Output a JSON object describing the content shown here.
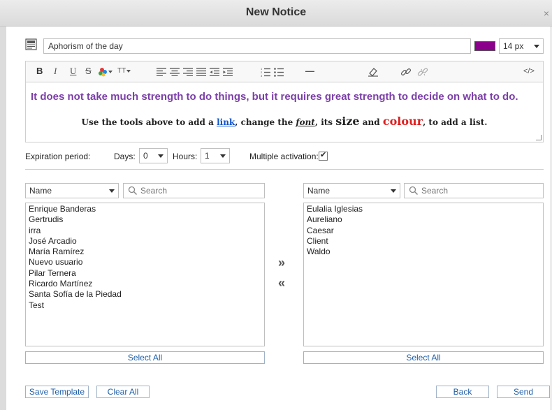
{
  "dialog": {
    "title": "New Notice",
    "close_glyph": "×"
  },
  "subject": {
    "value": "Aphorism of the day",
    "icon": "notice-icon"
  },
  "text_color": "#8b008b",
  "font_size": "14 px",
  "toolbar": {
    "bold": "B",
    "italic": "I",
    "underline": "U",
    "strike": "S",
    "font_size_glyph": "TT",
    "hr": "—",
    "source": "</>"
  },
  "editor": {
    "quote": "It does not take much strength to do things, but it requires great strength to decide on what to do.",
    "instr_1": "Use the tools above to add a ",
    "instr_link": "link",
    "instr_2": ", change the ",
    "instr_font": "font",
    "instr_3": ", its ",
    "instr_size": "size",
    "instr_4": " and ",
    "instr_colour": "colour",
    "instr_5": ", to add a list."
  },
  "expiration": {
    "label": "Expiration period:",
    "days_label": "Days:",
    "days_value": "0",
    "hours_label": "Hours:",
    "hours_value": "1",
    "multiple_label": "Multiple activation:",
    "multiple_checked": true
  },
  "left_panel": {
    "sort_value": "Name",
    "search_placeholder": "Search",
    "items": [
      "Enrique Banderas",
      "Gertrudis",
      "irra",
      "José Arcadio",
      "María Ramírez",
      "Nuevo usuario",
      "Pilar Ternera",
      "Ricardo Martínez",
      "Santa Sofía de la Piedad",
      "Test"
    ],
    "select_all": "Select All"
  },
  "transfer": {
    "right": "»",
    "left": "«"
  },
  "right_panel": {
    "sort_value": "Name",
    "search_placeholder": "Search",
    "items": [
      "Eulalia Iglesias",
      "Aureliano",
      "Caesar",
      "Client",
      "Waldo"
    ],
    "select_all": "Select All"
  },
  "footer": {
    "save_template": "Save Template",
    "clear_all": "Clear All",
    "back": "Back",
    "send": "Send"
  }
}
